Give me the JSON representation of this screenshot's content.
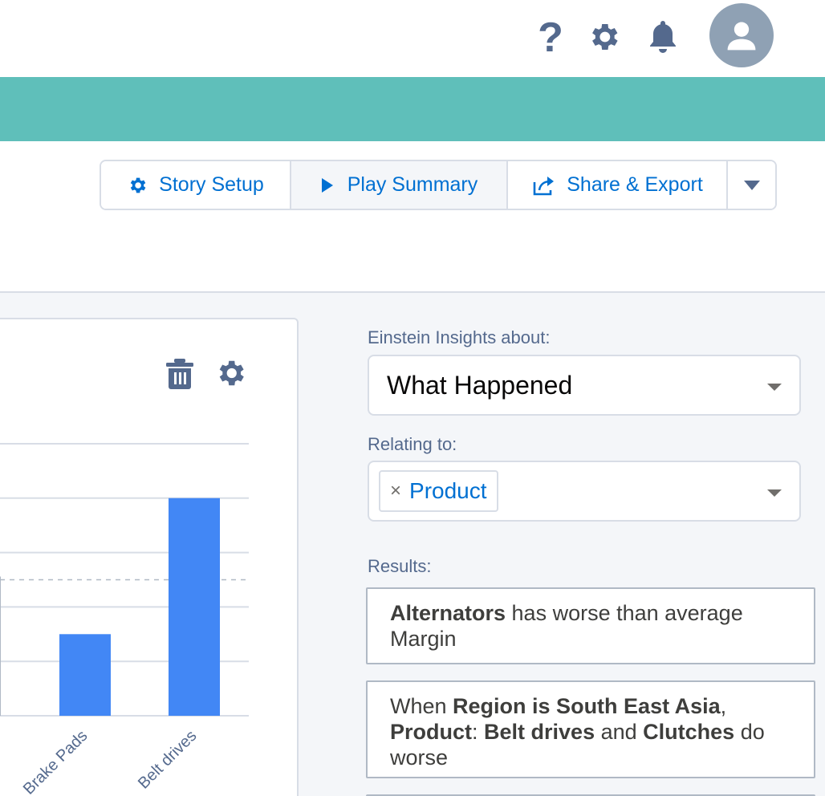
{
  "header": {
    "help_glyph": "?",
    "icons": [
      "help-icon",
      "gear-icon",
      "bell-icon",
      "avatar-icon"
    ],
    "brand_color": "#5fbfba"
  },
  "toolbar": {
    "story_setup_label": "Story Setup",
    "play_summary_label": "Play Summary",
    "share_export_label": "Share & Export"
  },
  "insights": {
    "about_label": "Einstein Insights about:",
    "about_value": "What Happened",
    "relating_label": "Relating to:",
    "relating_pill": "Product",
    "relating_pill_remove": "×",
    "results_label": "Results:",
    "results": [
      {
        "bold1": "Alternators",
        "text1": " has worse than average Margin"
      },
      {
        "text0": "When ",
        "bold1": "Region is South East Asia",
        "text1": ", ",
        "bold2": "Product",
        "text2": ": ",
        "bold3": "Belt drives",
        "text3": " and ",
        "bold4": "Clutches",
        "text4": " do worse"
      }
    ]
  },
  "chart_data": {
    "type": "bar",
    "categories": [
      "Brake Pads",
      "Belt drives"
    ],
    "values": [
      1.5,
      4.0
    ],
    "ylim": [
      0,
      5
    ],
    "reference_line": 2.5,
    "bar_color": "#4287f5",
    "grid": true
  }
}
